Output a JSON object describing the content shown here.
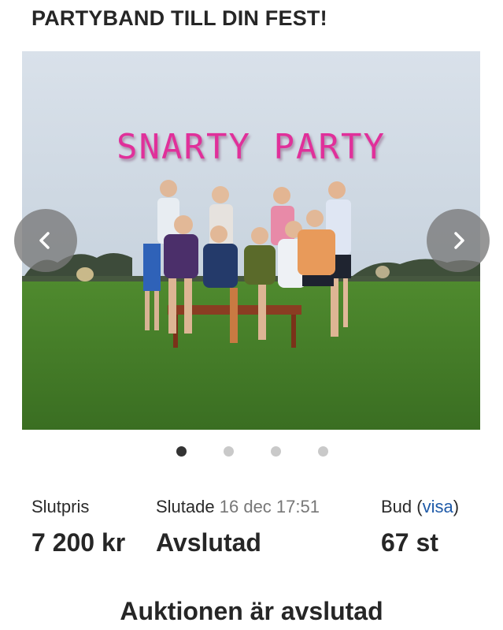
{
  "listing": {
    "title": "PARTYBAND TILL DIN FEST!",
    "image_caption": "SNARTY PARTY",
    "gallery": {
      "image_count": 4,
      "active_index": 0
    }
  },
  "stats": {
    "final_price_label": "Slutpris",
    "final_price_value": "7 200 kr",
    "ended_label": "Slutade",
    "ended_date": "16 dec 17:51",
    "ended_value": "Avslutad",
    "bids_label": "Bud",
    "bids_link_open": "(",
    "bids_link": "visa",
    "bids_link_close": ")",
    "bids_value": "67 st"
  },
  "footer": {
    "auction_status": "Auktionen är avslutad"
  },
  "colors": {
    "caption": "#e0309a",
    "link": "#1e5aa8",
    "nav_button": "#787878"
  },
  "icons": {
    "prev": "chevron-left-icon",
    "next": "chevron-right-icon"
  }
}
